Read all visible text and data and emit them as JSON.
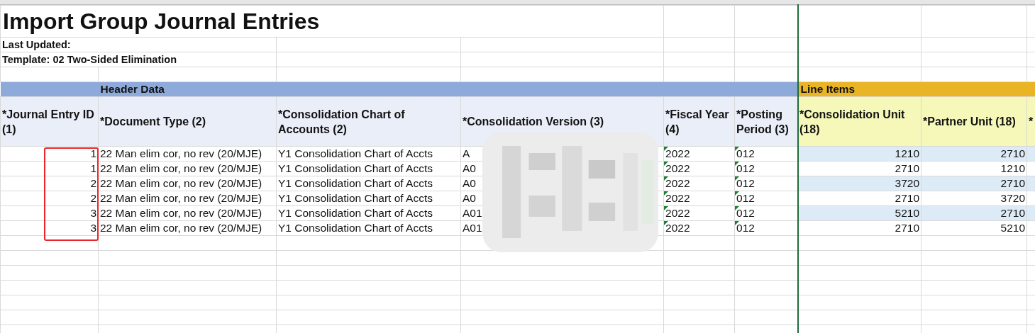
{
  "title": "Import Group Journal Entries",
  "info": [
    "Last Updated:",
    "Template: 02 Two-Sided Elimination"
  ],
  "sections": [
    {
      "label": "Header Data",
      "kind": "header",
      "columns": [
        {
          "label": "*Journal Entry ID (1)",
          "kind": "number"
        },
        {
          "label": "*Document Type (2)",
          "kind": "text"
        },
        {
          "label": "*Consolidation Chart of Accounts (2)",
          "kind": "text"
        },
        {
          "label": "*Consolidation Version (3)",
          "kind": "text"
        },
        {
          "label": "*Fiscal Year (4)",
          "kind": "flagged"
        },
        {
          "label": "*Posting Period (3)",
          "kind": "flagged"
        }
      ]
    },
    {
      "label": "Line Items",
      "kind": "line",
      "columns": [
        {
          "label": "*Consolidation Unit (18)",
          "kind": "number"
        },
        {
          "label": "*Partner Unit (18)",
          "kind": "number"
        },
        {
          "label": "*",
          "kind": "text"
        }
      ]
    }
  ],
  "rows": [
    {
      "cells": [
        "1",
        "22 Man elim cor, no rev (20/MJE)",
        "Y1 Consolidation Chart of Accts",
        "A",
        "2022",
        "012",
        "1210",
        "2710"
      ]
    },
    {
      "cells": [
        "1",
        "22 Man elim cor, no rev (20/MJE)",
        "Y1 Consolidation Chart of Accts",
        "A0",
        "2022",
        "012",
        "2710",
        "1210"
      ]
    },
    {
      "cells": [
        "2",
        "22 Man elim cor, no rev (20/MJE)",
        "Y1 Consolidation Chart of Accts",
        "A0",
        "2022",
        "012",
        "3720",
        "2710"
      ]
    },
    {
      "cells": [
        "2",
        "22 Man elim cor, no rev (20/MJE)",
        "Y1 Consolidation Chart of Accts",
        "A0",
        "2022",
        "012",
        "2710",
        "3720"
      ]
    },
    {
      "cells": [
        "3",
        "22 Man elim cor, no rev (20/MJE)",
        "Y1 Consolidation Chart of Accts",
        "A01",
        "2022",
        "012",
        "5210",
        "2710"
      ]
    },
    {
      "cells": [
        "3",
        "22 Man elim cor, no rev (20/MJE)",
        "Y1 Consolidation Chart of Accts",
        "A01",
        "2022",
        "012",
        "2710",
        "5210"
      ]
    }
  ]
}
